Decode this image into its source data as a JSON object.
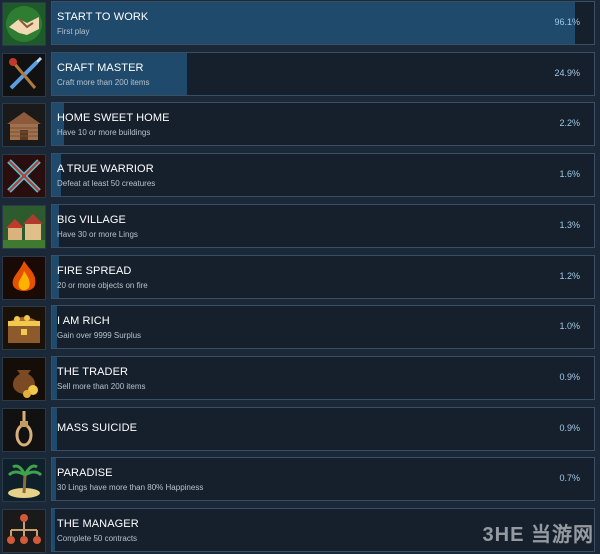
{
  "achievements": [
    {
      "title": "START TO WORK",
      "desc": "First play",
      "percent_text": "96.1%",
      "percent": 96.1,
      "icon": "handshake-icon"
    },
    {
      "title": "CRAFT MASTER",
      "desc": "Craft more than 200 items",
      "percent_text": "24.9%",
      "percent": 24.9,
      "icon": "crossed-tools-icon"
    },
    {
      "title": "HOME SWEET HOME",
      "desc": "Have 10 or more buildings",
      "percent_text": "2.2%",
      "percent": 2.2,
      "icon": "wooden-house-icon"
    },
    {
      "title": "A TRUE WARRIOR",
      "desc": "Defeat at least 50 creatures",
      "percent_text": "1.6%",
      "percent": 1.6,
      "icon": "crossed-swords-icon"
    },
    {
      "title": "BIG VILLAGE",
      "desc": "Have 30 or more Lings",
      "percent_text": "1.3%",
      "percent": 1.3,
      "icon": "village-icon"
    },
    {
      "title": "FIRE SPREAD",
      "desc": "20 or more objects on fire",
      "percent_text": "1.2%",
      "percent": 1.2,
      "icon": "fire-icon"
    },
    {
      "title": "I AM RICH",
      "desc": "Gain over 9999 Surplus",
      "percent_text": "1.0%",
      "percent": 1.0,
      "icon": "treasure-chest-icon"
    },
    {
      "title": "THE TRADER",
      "desc": "Sell more than 200 items",
      "percent_text": "0.9%",
      "percent": 0.9,
      "icon": "money-bag-icon"
    },
    {
      "title": "MASS SUICIDE",
      "desc": "",
      "percent_text": "0.9%",
      "percent": 0.9,
      "icon": "noose-icon"
    },
    {
      "title": "PARADISE",
      "desc": "30 Lings have more than 80% Happiness",
      "percent_text": "0.7%",
      "percent": 0.7,
      "icon": "palm-island-icon"
    },
    {
      "title": "THE MANAGER",
      "desc": "Complete 50 contracts",
      "percent_text": "",
      "percent": 0.5,
      "icon": "org-chart-icon"
    }
  ],
  "watermark": "3HE 当游网",
  "colors": {
    "background": "#1b2838",
    "bar_fill": "#1f4a6c",
    "percent_text": "#9fc9e8"
  }
}
